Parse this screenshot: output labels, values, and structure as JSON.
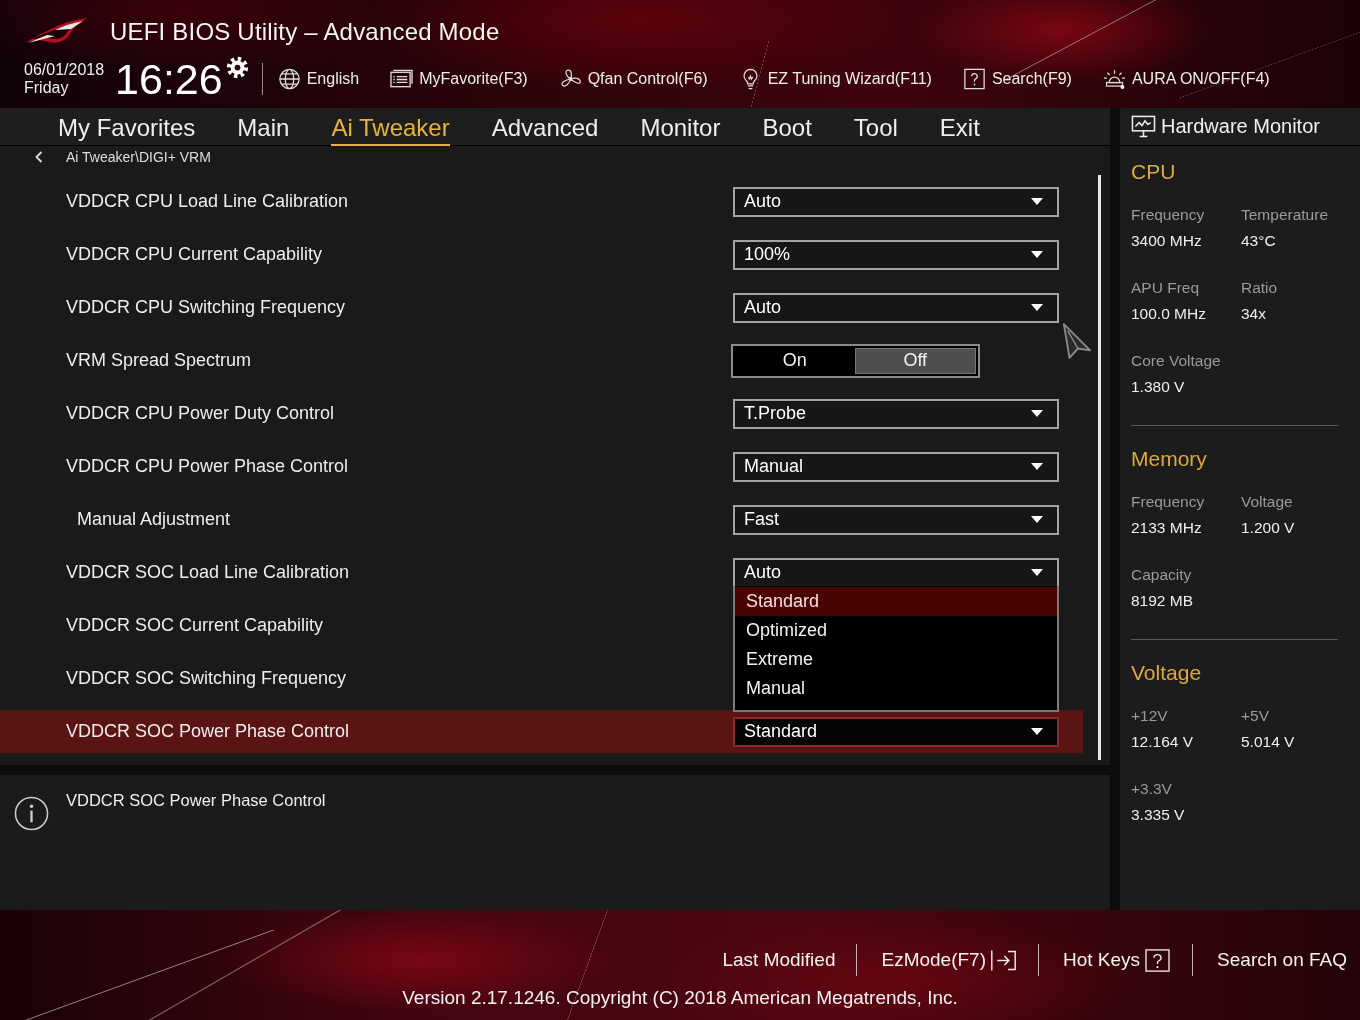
{
  "window": {
    "title": "UEFI BIOS Utility – Advanced Mode"
  },
  "clock": {
    "date": "06/01/2018",
    "day": "Friday",
    "time": "16:26"
  },
  "toolbar": [
    "English",
    "MyFavorite(F3)",
    "Qfan Control(F6)",
    "EZ Tuning Wizard(F11)",
    "Search(F9)",
    "AURA ON/OFF(F4)"
  ],
  "tabs": [
    {
      "label": "My Favorites",
      "selected": false
    },
    {
      "label": "Main",
      "selected": false
    },
    {
      "label": "Ai Tweaker",
      "selected": true
    },
    {
      "label": "Advanced",
      "selected": false
    },
    {
      "label": "Monitor",
      "selected": false
    },
    {
      "label": "Boot",
      "selected": false
    },
    {
      "label": "Tool",
      "selected": false
    },
    {
      "label": "Exit",
      "selected": false
    }
  ],
  "breadcrumb": "Ai Tweaker\\DIGI+ VRM",
  "settings": [
    {
      "label": "VDDCR CPU Load Line Calibration",
      "kind": "dropdown",
      "value": "Auto",
      "expanded": false,
      "selected": false
    },
    {
      "label": "VDDCR CPU Current Capability",
      "kind": "dropdown",
      "value": "100%",
      "expanded": false,
      "selected": false
    },
    {
      "label": "VDDCR CPU Switching Frequency",
      "kind": "dropdown",
      "value": "Auto",
      "expanded": false,
      "selected": false
    },
    {
      "label": "VRM Spread Spectrum",
      "kind": "toggle",
      "options": [
        {
          "label": "On",
          "selected": false
        },
        {
          "label": "Off",
          "selected": true
        }
      ],
      "selected": false
    },
    {
      "label": "VDDCR CPU Power Duty Control",
      "kind": "dropdown",
      "value": "T.Probe",
      "expanded": false,
      "selected": false
    },
    {
      "label": "VDDCR CPU Power Phase Control",
      "kind": "dropdown",
      "value": "Manual",
      "expanded": false,
      "selected": false,
      "children": [
        {
          "label": "Manual Adjustment",
          "kind": "dropdown",
          "value": "Fast",
          "expanded": false,
          "selected": false
        }
      ]
    },
    {
      "label": "VDDCR SOC Load Line Calibration",
      "kind": "dropdown",
      "value": "Auto",
      "expanded": true,
      "selected": false,
      "options": [
        {
          "label": "Standard",
          "selected": true
        },
        {
          "label": "Optimized",
          "selected": false
        },
        {
          "label": "Extreme",
          "selected": false
        },
        {
          "label": "Manual",
          "selected": false
        }
      ]
    },
    {
      "label": "VDDCR SOC Current Capability",
      "selected": false
    },
    {
      "label": "VDDCR SOC Switching Frequency",
      "selected": false
    },
    {
      "label": "VDDCR SOC Power Phase Control",
      "kind": "dropdown",
      "value": "Standard",
      "expanded": false,
      "selected": true
    }
  ],
  "help": {
    "text": "VDDCR SOC Power Phase Control"
  },
  "hardware_monitor": {
    "title": "Hardware Monitor",
    "sections": [
      {
        "title": "CPU",
        "items": [
          {
            "label": "Frequency",
            "value": "3400 MHz"
          },
          {
            "label": "Temperature",
            "value": "43°C"
          },
          {
            "label": "APU Freq",
            "value": "100.0 MHz"
          },
          {
            "label": "Ratio",
            "value": "34x"
          },
          {
            "label": "Core Voltage",
            "value": "1.380 V"
          }
        ]
      },
      {
        "title": "Memory",
        "items": [
          {
            "label": "Frequency",
            "value": "2133 MHz"
          },
          {
            "label": "Voltage",
            "value": "1.200 V"
          },
          {
            "label": "Capacity",
            "value": "8192 MB"
          }
        ]
      },
      {
        "title": "Voltage",
        "items": [
          {
            "label": "+12V",
            "value": "12.164 V"
          },
          {
            "label": "+5V",
            "value": "5.014 V"
          },
          {
            "label": "+3.3V",
            "value": "3.335 V"
          }
        ]
      }
    ]
  },
  "footer": {
    "items": [
      "Last Modified",
      "EzMode(F7)",
      "Hot Keys",
      "Search on FAQ"
    ],
    "version": "Version 2.17.1246. Copyright (C) 2018 American Megatrends, Inc."
  }
}
